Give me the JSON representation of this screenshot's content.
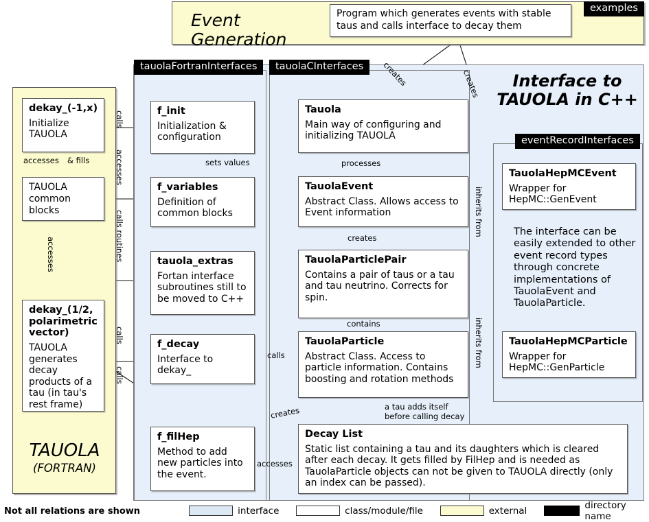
{
  "title": "TAUOLA C++ Interface structure diagram",
  "top_panel": {
    "heading": "Event Generation",
    "dir_tag": "examples",
    "description_box": "Program which generates events with stable taus and calls interface to decay them"
  },
  "left_panel": {
    "name_main": "TAUOLA",
    "name_sub": "(FORTRAN)",
    "boxes": [
      {
        "title": "dekay_(-1,x)",
        "body": "Initialize TAUOLA"
      },
      {
        "title": "TAUOLA common blocks",
        "body": ""
      },
      {
        "title": "dekay_(1/2, polarimetric vector)",
        "body": "TAUOLA generates decay products of a tau (in tau's rest frame)"
      }
    ]
  },
  "fortran_interfaces": {
    "dir_tag": "tauolaFortranInterfaces",
    "boxes": [
      {
        "title": "f_init",
        "body": "Initialization & configuration"
      },
      {
        "title": "f_variables",
        "body": "Definition of common blocks"
      },
      {
        "title": "tauola_extras",
        "body": "Fortan interface subroutines still to be moved to C++"
      },
      {
        "title": "f_decay",
        "body": "Interface to dekay_"
      },
      {
        "title": "f_filHep",
        "body": "Method to add new particles into the event."
      }
    ]
  },
  "c_interfaces": {
    "dir_tag": "tauolaCInterfaces",
    "boxes": [
      {
        "title": "Tauola",
        "body": "Main way of configuring and initializing TAUOLA"
      },
      {
        "title": "TauolaEvent",
        "body": "Abstract Class. Allows access to Event information"
      },
      {
        "title": "TauolaParticlePair",
        "body": "Contains a pair of taus or a tau and tau neutrino. Corrects for spin."
      },
      {
        "title": "TauolaParticle",
        "body": "Abstract Class. Access to particle information. Contains boosting and rotation methods"
      },
      {
        "title": "Decay List",
        "body": "Static list containing a tau and its daughters which is cleared after each decay. It gets filled by FilHep and is needed as TauolaParticle objects can not be given to TAUOLA directly (only an index can be passed)."
      }
    ]
  },
  "event_record_interfaces": {
    "dir_tag": "eventRecordInterfaces",
    "boxes": [
      {
        "title": "TauolaHepMCEvent",
        "body": "Wrapper for HepMC::GenEvent"
      },
      {
        "title": "TauolaHepMCParticle",
        "body": "Wrapper for HepMC::GenParticle"
      }
    ],
    "note": "The interface can be easily extended to other event record types through concrete implementations of TauolaEvent and TauolaParticle."
  },
  "interface_heading": {
    "line1": "Interface to",
    "line2": "TAUOLA in C++"
  },
  "edge_labels": {
    "calls_1": "calls",
    "accesses_1": "accesses",
    "calls_routines": "calls routines",
    "calls_2": "calls",
    "calls_3": "calls",
    "accesses_left": "accesses",
    "and_fills": "& fills",
    "accesses_vert": "accesses",
    "sets_values": "sets values",
    "processes": "processes",
    "creates_mid": "creates",
    "contains": "contains",
    "calls_td": "calls",
    "creates_top_left": "creates",
    "creates_top_right": "creates",
    "creates_fh": "creates",
    "accesses_dl": "accesses",
    "tau_adds_1": "a tau adds itself",
    "tau_adds_2": "before calling decay",
    "inherits_from_1": "inherits from",
    "inherits_from_2": "inherits from"
  },
  "footnote": "Not all relations are shown",
  "legend": {
    "items": [
      {
        "label": "interface",
        "color": "#dde8f5",
        "text_color": "#000"
      },
      {
        "label": "class/module/file",
        "color": "#ffffff",
        "text_color": "#000"
      },
      {
        "label": "external",
        "color": "#fbfbcf",
        "text_color": "#000"
      },
      {
        "label": "directory name",
        "color": "#000000",
        "text_color": "#000"
      }
    ]
  },
  "colors": {
    "interface_blue": "#e6effa",
    "external_yellow": "#fbfbcf",
    "dir_black": "#000000",
    "box_white": "#ffffff"
  }
}
